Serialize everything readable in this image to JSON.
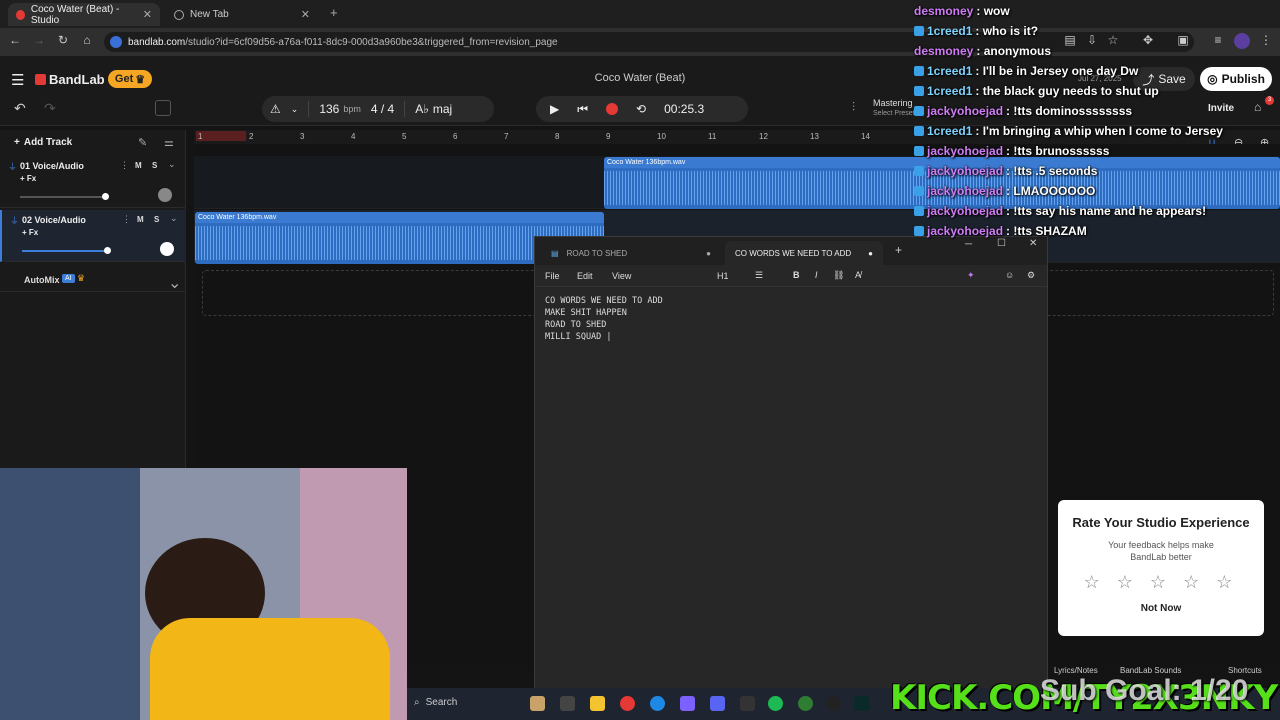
{
  "browser": {
    "tabs": [
      {
        "title": "Coco Water (Beat) - Studio",
        "active": true
      },
      {
        "title": "New Tab",
        "active": false
      }
    ],
    "url_host": "bandlab.com",
    "url_path": "/studio?id=6cf09d56-a76a-f011-8dc9-000d3a960be3&triggered_from=revision_page"
  },
  "bandlab": {
    "logo": "BandLab",
    "get_button": "Get",
    "project_title": "Coco Water (Beat)",
    "save_label": "Save",
    "publish_label": "Publish",
    "invite_label": "Invite",
    "notif_count": "3",
    "bpm_value": "136",
    "bpm_unit": "bpm",
    "time_sig": "4 / 4",
    "key": "maj",
    "time": "00:25.3",
    "mastering_label": "Mastering",
    "mastering_sub": "Select Preset",
    "add_track": "Add Track",
    "automix": "AutoMix",
    "automix_badge": "AI",
    "ruler": [
      "1",
      "2",
      "3",
      "4",
      "5",
      "6",
      "7",
      "8",
      "9",
      "10",
      "11",
      "12",
      "13",
      "14"
    ],
    "tracks": [
      {
        "name": "01  Voice/Audio",
        "fx": "+ Fx",
        "m": "M",
        "s": "S"
      },
      {
        "name": "02  Voice/Audio",
        "fx": "+ Fx",
        "m": "M",
        "s": "S"
      }
    ],
    "clip1_label": "Coco Water 136bpm.wav",
    "clip2_label": "Coco Water 136bpm.wav",
    "lyrics_notes": "Lyrics/Notes",
    "bandlab_sounds": "BandLab Sounds",
    "shortcuts": "Shortcuts",
    "saved_date": "Jul 27, 2025"
  },
  "chat": [
    {
      "user": "desmoney",
      "msg": ": wow",
      "badge": false
    },
    {
      "user": "1creed1",
      "msg": ": who is it?",
      "badge": true
    },
    {
      "user": "desmoney",
      "msg": ": anonymous",
      "badge": false
    },
    {
      "user": "1creed1",
      "msg": ": I'll be in Jersey one day Dw",
      "badge": true
    },
    {
      "user": "1creed1",
      "msg": ": the black guy needs to shut up",
      "badge": true
    },
    {
      "user": "jackyohoejad",
      "msg": ": !tts dominossssssss",
      "badge": true
    },
    {
      "user": "1creed1",
      "msg": ": I'm bringing a whip when I come to Jersey",
      "badge": true
    },
    {
      "user": "jackyohoejad",
      "msg": ": !tts brunossssss",
      "badge": true
    },
    {
      "user": "jackyohoejad",
      "msg": ": !tts .5 seconds",
      "badge": true
    },
    {
      "user": "jackyohoejad",
      "msg": ": LMAOOOOOO",
      "badge": true
    },
    {
      "user": "jackyohoejad",
      "msg": ": !tts say his name and he appears!",
      "badge": true
    },
    {
      "user": "jackyohoejad",
      "msg": ": !tts SHAZAM",
      "badge": true
    }
  ],
  "notepad": {
    "tabs": [
      "ROAD TO SHED",
      "CO WORDS WE NEED TO ADD"
    ],
    "menu": [
      "File",
      "Edit",
      "View"
    ],
    "heading": "H1",
    "lines": [
      "CO WORDS WE NEED TO ADD",
      "MAKE SHIT HAPPEN",
      "ROAD TO SHED",
      "MILLI SQUAD |"
    ]
  },
  "rate": {
    "title": "Rate Your Studio Experience",
    "sub": "Your feedback helps make BandLab better",
    "stars": "☆ ☆ ☆ ☆ ☆",
    "not_now": "Not Now"
  },
  "taskbar": {
    "search": "Search"
  },
  "overlay": {
    "kick": "KICK.COM/TY2X3NKY",
    "subgoal": "Sub Goal: 1/20"
  },
  "colors": {
    "accent": "#3b7dd8",
    "record": "#e53935",
    "get": "#f5a623",
    "kick": "#55e01a"
  }
}
